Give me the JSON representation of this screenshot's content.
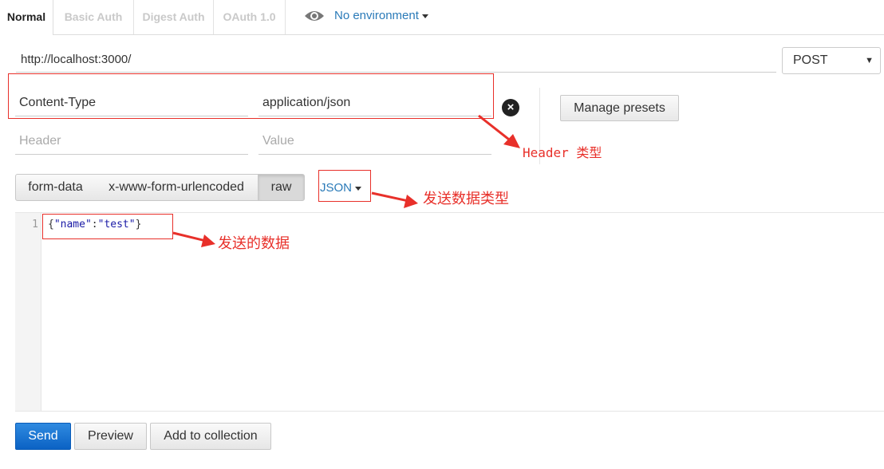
{
  "tabs": [
    {
      "label": "Normal",
      "active": true
    },
    {
      "label": "Basic Auth",
      "active": false
    },
    {
      "label": "Digest Auth",
      "active": false
    },
    {
      "label": "OAuth 1.0",
      "active": false
    }
  ],
  "environment": {
    "label": "No environment",
    "icon": "eye-icon"
  },
  "request": {
    "url": "http://localhost:3000/",
    "method": "POST"
  },
  "headers": {
    "rows": [
      {
        "key": "Content-Type",
        "value": "application/json"
      }
    ],
    "key_placeholder": "Header",
    "value_placeholder": "Value",
    "manage_presets_label": "Manage presets"
  },
  "body": {
    "modes": [
      "form-data",
      "x-www-form-urlencoded",
      "raw"
    ],
    "active_mode": "raw",
    "raw_type": "JSON",
    "editor": {
      "line_numbers": [
        "1"
      ],
      "code": "{\"name\":\"test\"}"
    }
  },
  "actions": {
    "send": "Send",
    "preview": "Preview",
    "add_to_collection": "Add to collection"
  },
  "annotations": {
    "header_type": "Header 类型",
    "send_data_type": "发送数据类型",
    "sent_data": "发送的数据",
    "color": "#e8302a"
  },
  "colors": {
    "accent": "#2a7ab8",
    "send_button": "#1a73d1"
  }
}
